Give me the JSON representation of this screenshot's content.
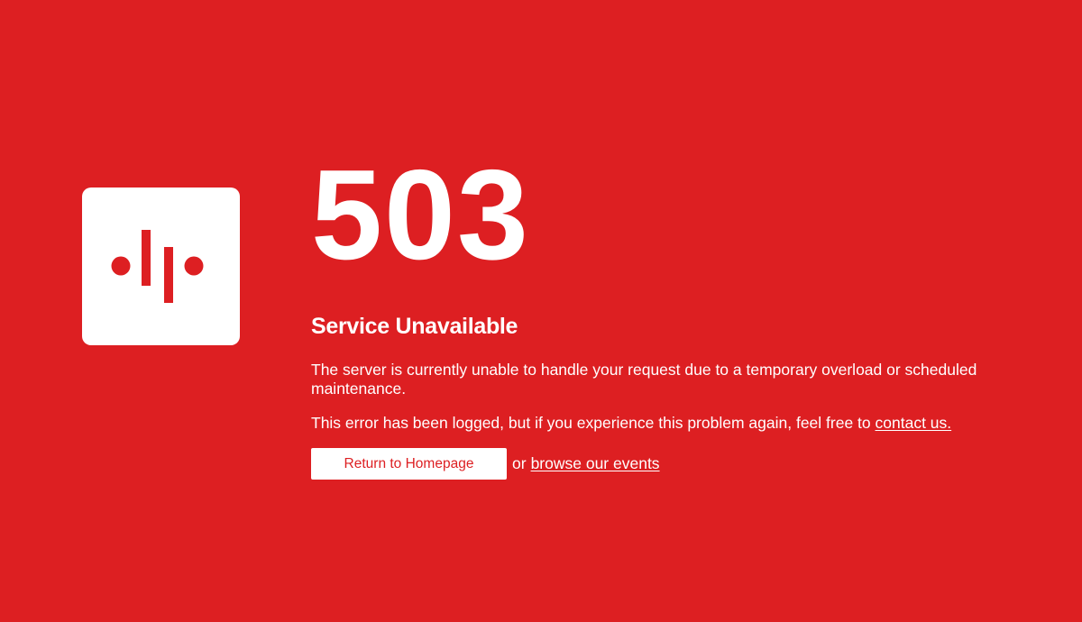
{
  "logo": {
    "icon": "bars-and-dots-logo-icon",
    "colors": {
      "background": "#ffffff",
      "mark": "#dd1f22"
    }
  },
  "error": {
    "code": "503",
    "title": "Service Unavailable",
    "message": "The server is currently unable to handle your request due to a temporary overload or scheduled maintenance.",
    "logged_prefix": "This error has been logged, but if you experience this problem again, feel free to ",
    "contact_link": "contact us."
  },
  "actions": {
    "home_button": "Return to Homepage",
    "or_text": "or",
    "events_link": "browse our events"
  },
  "colors": {
    "background": "#dd1f22",
    "text": "#ffffff",
    "button_text": "#dd1f22"
  }
}
